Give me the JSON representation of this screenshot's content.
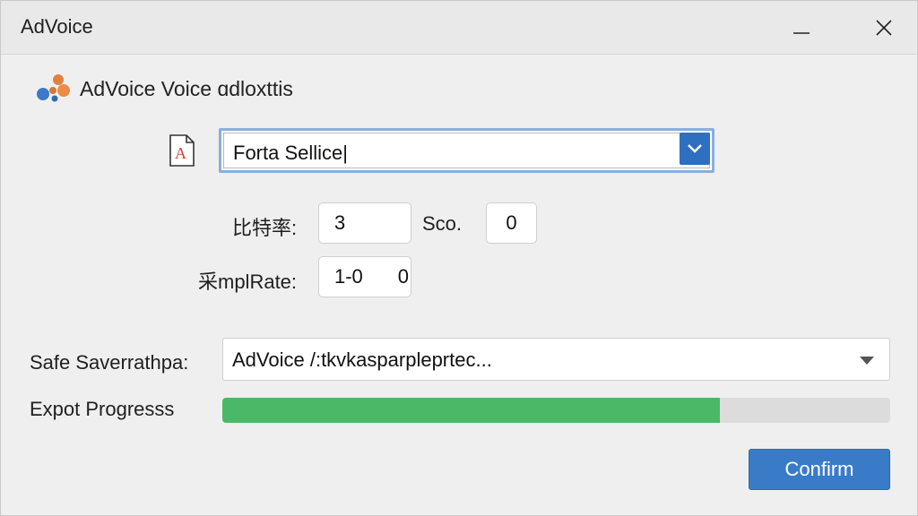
{
  "window": {
    "title": "AdVoice",
    "controls": {
      "minimize": "minimize-icon",
      "close": "close-icon"
    }
  },
  "header": {
    "logo_icon": "advoice-logo-icon",
    "heading": "AdVoice Voice ɑdloxttis"
  },
  "format": {
    "icon": "text-file-icon",
    "selected": "Forta Sellice|",
    "dropdown_icon": "chevron-down-icon"
  },
  "bitrate": {
    "label": "比特率:",
    "value": "3"
  },
  "sco": {
    "label": "Sco.",
    "value": "0"
  },
  "sample_rate": {
    "label": "采mplRate:",
    "value_left": "1-0",
    "value_right": "0"
  },
  "save_path": {
    "label": "Safe Saverrathpa:",
    "value": "AdVoice /:tkvkasparpleprtec...",
    "dropdown_icon": "triangle-down-icon"
  },
  "progress": {
    "label": "Expot Progresss",
    "fraction": 0.745,
    "color": "#4bb865"
  },
  "confirm": {
    "label": "Confirm",
    "color": "#3a7bc8"
  },
  "colors": {
    "accent": "#2e6fbf",
    "focus_border": "#89aee0"
  }
}
